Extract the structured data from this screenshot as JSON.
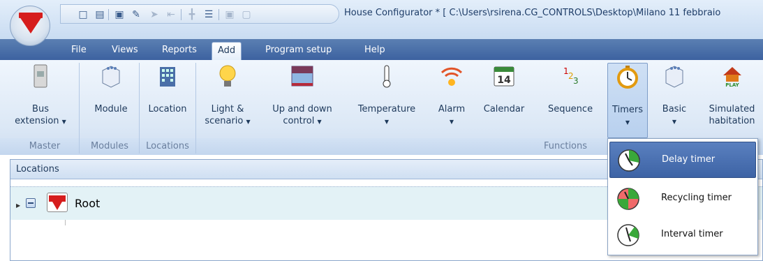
{
  "window": {
    "title": "House Configurator * [ C:\\Users\\rsirena.CG_CONTROLS\\Desktop\\Milano 11 febbraio"
  },
  "menu_tabs": [
    "File",
    "Views",
    "Reports",
    "Add",
    "Program setup",
    "Help"
  ],
  "active_tab": "Add",
  "ribbon": {
    "groups": {
      "master": "Master",
      "modules": "Modules",
      "locations": "Locations",
      "functions": "Functions"
    },
    "buttons": {
      "bus_extension": {
        "line1": "Bus",
        "line2": "extension"
      },
      "module": {
        "line1": "Module"
      },
      "location": {
        "line1": "Location"
      },
      "light_scenario": {
        "line1": "Light &",
        "line2": "scenario"
      },
      "up_down_control": {
        "line1": "Up and down",
        "line2": "control"
      },
      "temperature": {
        "line1": "Temperature"
      },
      "alarm": {
        "line1": "Alarm"
      },
      "calendar": {
        "line1": "Calendar",
        "icon_text": "14"
      },
      "sequence": {
        "line1": "Sequence"
      },
      "timers": {
        "line1": "Timers"
      },
      "basic": {
        "line1": "Basic"
      },
      "simulated_habitation": {
        "line1": "Simulated",
        "line2": "habitation",
        "icon_text": "PLAY"
      }
    }
  },
  "locations_pane": {
    "header": "Locations",
    "tree": [
      {
        "label": "Root",
        "expanded": true
      }
    ]
  },
  "timers_dropdown": {
    "items": [
      {
        "label": "Delay timer",
        "selected": true,
        "icon": "delay-timer-icon"
      },
      {
        "label": "Recycling timer",
        "selected": false,
        "icon": "recycling-timer-icon"
      },
      {
        "label": "Interval timer",
        "selected": false,
        "icon": "interval-timer-icon"
      }
    ]
  },
  "colors": {
    "brand_red": "#d61d1d",
    "tab_bar": "#3d62a0",
    "selected_item": "#3d63a5"
  }
}
